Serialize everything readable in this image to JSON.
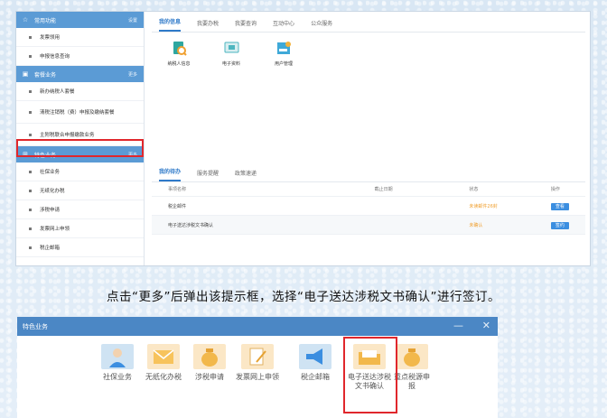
{
  "sidebar": {
    "sections": [
      {
        "title": "常用功能",
        "more": "设置",
        "items": [
          "发票领用",
          "申报信息查询"
        ]
      },
      {
        "title": "套餐业务",
        "more": "更多",
        "items": [
          "新办纳税人套餐",
          "清税注销税（费）申报及缴纳套餐",
          "主附税联合申报缴款业务"
        ]
      },
      {
        "title": "特色业务",
        "more": "更多",
        "items": [
          "社保业务",
          "无纸化办税",
          "涉税申请",
          "发票网上申领",
          "税企邮箱"
        ]
      }
    ]
  },
  "top_panel": {
    "tabs": [
      "我的信息",
      "我要办税",
      "我要查询",
      "互动中心",
      "公众服务"
    ],
    "tiles": [
      "纳税人信息",
      "电子资料",
      "用户管理"
    ]
  },
  "todo_panel": {
    "tabs": [
      "我的待办",
      "服务提醒",
      "政策速递"
    ],
    "headers": [
      "事项名称",
      "截止日期",
      "状态",
      "操作"
    ],
    "rows": [
      {
        "name": "税企邮件",
        "deadline": "",
        "status": "未读邮件26封",
        "action": "查看"
      },
      {
        "name": "电子送达涉税文书确认",
        "deadline": "",
        "status": "未确认",
        "action": "签约"
      }
    ]
  },
  "caption": "点击“更多”后弹出该提示框，选择“电子送达涉税文书确认”进行签订。",
  "dialog": {
    "title": "特色业务",
    "minimize": "—",
    "close": "✕",
    "tiles": [
      {
        "label": "社保业务"
      },
      {
        "label": "无纸化办税"
      },
      {
        "label": "涉税申请"
      },
      {
        "label": "发票网上申领"
      },
      {
        "label": "税企邮箱"
      },
      {
        "label": "电子送达涉税文书确认"
      },
      {
        "label": "重点税源申报"
      }
    ]
  },
  "colors": {
    "header_blue": "#5b9bd5",
    "highlight_red": "#e0272c",
    "link_blue": "#2f7ac9",
    "status_orange": "#f0a030"
  }
}
